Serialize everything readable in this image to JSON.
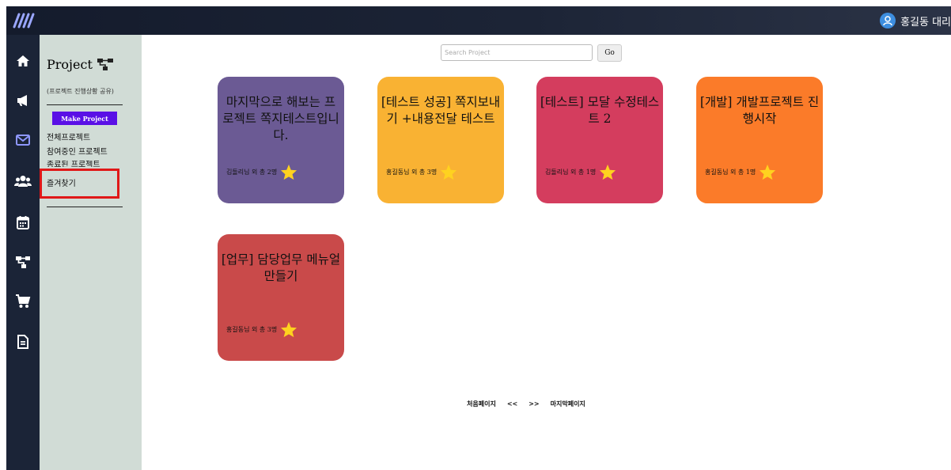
{
  "header": {
    "user_name": "홍길동 대리"
  },
  "sidebar": {
    "icons": [
      "home-icon",
      "megaphone-icon",
      "mail-icon",
      "users-icon",
      "calendar-icon",
      "sitemap-icon",
      "cart-icon",
      "document-icon"
    ]
  },
  "panel": {
    "title": "Project",
    "subtitle": "(프로젝트 진행상황 공유)",
    "make_button": "Make Project",
    "menu": [
      "전체프로젝트",
      "참여중인 프로젝트",
      "종료된 프로젝트",
      "즐겨찾기"
    ]
  },
  "search": {
    "placeholder": "Search Project",
    "go_label": "Go"
  },
  "projects": [
    {
      "title": "마지막으로 해보는 프로젝트 쪽지테스트입니다.",
      "members": "김돌리님 외 총 2명",
      "color": "#6b5a94"
    },
    {
      "title": "[테스트 성공] 쪽지보내기 +내용전달 테스트",
      "members": "홍길동님 외 총 3명",
      "color": "#f9b233"
    },
    {
      "title": "[테스트] 모달 수정테스트 2",
      "members": "김돌리님 외 총 1명",
      "color": "#d43d5e"
    },
    {
      "title": "[개발] 개발프로젝트 진행시작",
      "members": "홍길동님 외 총 1명",
      "color": "#fb7b29"
    },
    {
      "title": "[업무] 담당업무 메뉴얼 만들기",
      "members": "홍길동님 외 총 3명",
      "color": "#c94a4a"
    }
  ],
  "pagination": {
    "first": "처음페이지",
    "prev": "<<",
    "next": ">>",
    "last": "마지막페이지"
  },
  "colors": {
    "topbar": "#1a2233",
    "sidebar": "#1b2437",
    "panel": "#d1dcd6",
    "make_button": "#5a10e6",
    "star": "#ffd21f"
  }
}
